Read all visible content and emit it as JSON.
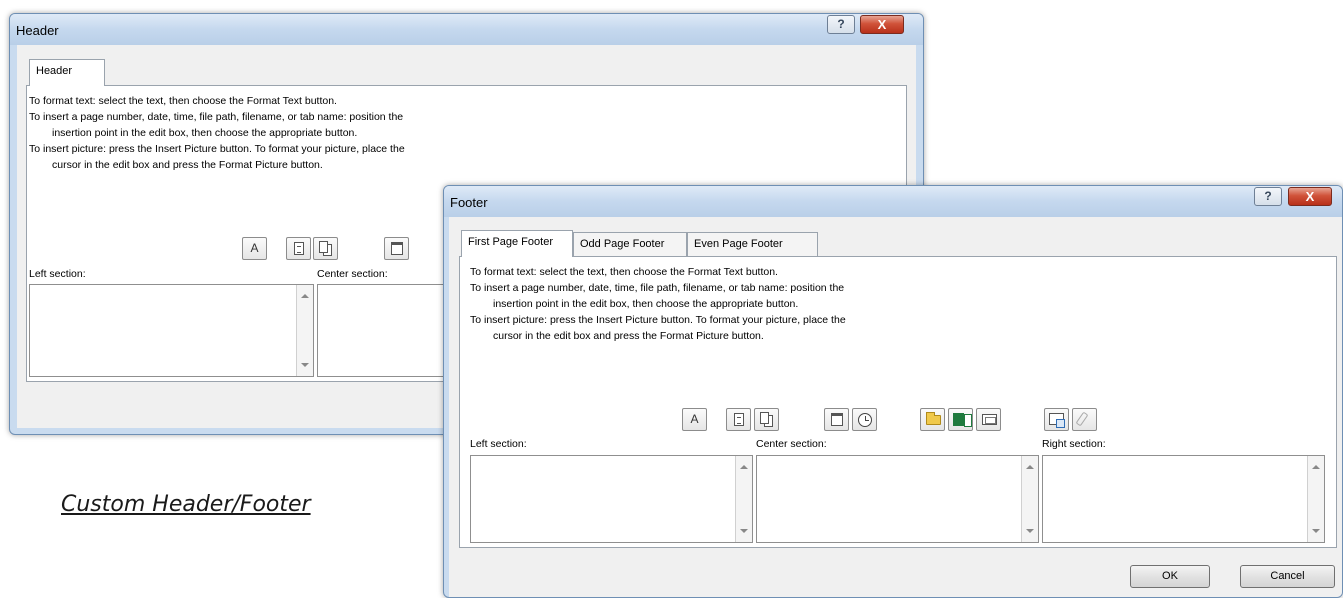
{
  "header_dialog": {
    "title": "Header",
    "help_label": "?",
    "close_label": "X",
    "tabs": [
      {
        "label": "Header"
      }
    ],
    "instructions": [
      "To format text:  select the text, then choose the Format Text button.",
      "To insert a page number, date, time, file path, filename, or tab name:  position the",
      "insertion point in the edit box, then choose the appropriate button.",
      "To insert picture: press the Insert Picture button.  To format your picture, place the",
      "cursor in the edit box and press the Format Picture button."
    ],
    "format_text_label": "A",
    "left_section_label": "Left section:",
    "center_section_label": "Center section:"
  },
  "footer_dialog": {
    "title": "Footer",
    "help_label": "?",
    "close_label": "X",
    "tabs": [
      {
        "label": "First Page Footer"
      },
      {
        "label": "Odd Page Footer"
      },
      {
        "label": "Even Page Footer"
      }
    ],
    "instructions": [
      "To format text:  select the text, then choose the Format Text button.",
      "To insert a page number, date, time, file path, filename, or tab name:  position the",
      "insertion point in the edit box, then choose the appropriate button.",
      "To insert picture: press the Insert Picture button.  To format your picture, place the",
      "cursor in the edit box and press the Format Picture button."
    ],
    "format_text_label": "A",
    "left_section_label": "Left section:",
    "center_section_label": "Center section:",
    "right_section_label": "Right section:",
    "ok_label": "OK",
    "cancel_label": "Cancel"
  },
  "icons": {
    "format_text": "format-text-icon",
    "page_number": "insert-page-number-icon",
    "number_of_pages": "insert-number-of-pages-icon",
    "date": "insert-date-icon",
    "time": "insert-time-icon",
    "file_path": "insert-file-path-icon",
    "file_name": "insert-file-name-icon",
    "sheet_name": "insert-sheet-name-icon",
    "picture": "insert-picture-icon",
    "format_picture": "format-picture-icon"
  },
  "colors": {
    "window_frame": "#c9dbef",
    "close_button": "#c8422a",
    "dialog_body": "#f0f0f0"
  },
  "caption": "Custom Header/Footer"
}
